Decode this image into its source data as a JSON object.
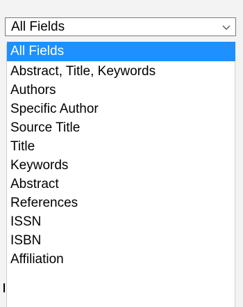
{
  "select": {
    "value": "All Fields",
    "icon": "chevron-down-icon",
    "options": [
      "All Fields",
      "Abstract, Title, Keywords",
      "Authors",
      "Specific Author",
      "Source Title",
      "Title",
      "Keywords",
      "Abstract",
      "References",
      "ISSN",
      "ISBN",
      "Affiliation"
    ],
    "highlighted_index": 0
  },
  "colors": {
    "highlight": "#1e90ff",
    "highlight_text": "#ffffff",
    "border": "#7a7a7a"
  }
}
